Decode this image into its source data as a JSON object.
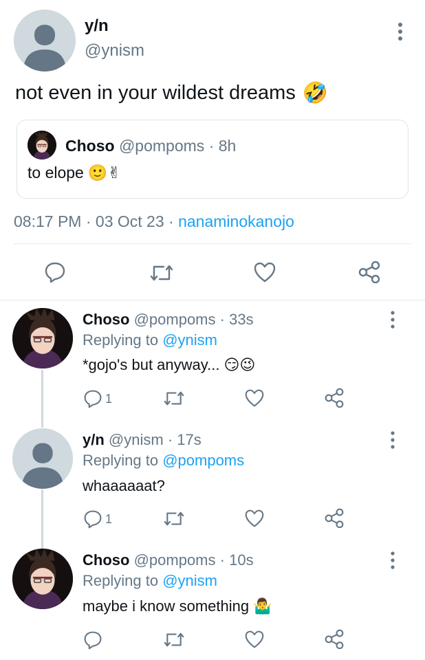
{
  "main_tweet": {
    "name": "y/n",
    "handle": "@ynism",
    "text": "not even in your wildest dreams",
    "emoji": "🤣",
    "quote": {
      "name": "Choso",
      "handle": "@pompoms",
      "separator": "·",
      "time": "8h",
      "text": "to elope",
      "emoji": "🙂✌"
    },
    "meta": {
      "time": "08:17 PM",
      "sep1": "·",
      "date": "03 Oct 23",
      "sep2": "·",
      "source": "nanaminokanojo"
    }
  },
  "replies": [
    {
      "name": "Choso",
      "handle": "@pompoms",
      "separator": "·",
      "time": "33s",
      "replying_label": "Replying to",
      "replying_to": "@ynism",
      "text": "*gojo's but anyway...",
      "emoji": "😏😉",
      "reply_count": "1",
      "avatar": "choso"
    },
    {
      "name": "y/n",
      "handle": "@ynism",
      "separator": "·",
      "time": "17s",
      "replying_label": "Replying to",
      "replying_to": "@pompoms",
      "text": "whaaaaaat?",
      "emoji": "",
      "reply_count": "1",
      "avatar": "default"
    },
    {
      "name": "Choso",
      "handle": "@pompoms",
      "separator": "·",
      "time": "10s",
      "replying_label": "Replying to",
      "replying_to": "@ynism",
      "text": "maybe i know something",
      "emoji": "🤷‍♂️",
      "reply_count": "",
      "avatar": "choso"
    }
  ],
  "icons": {
    "reply": "reply-icon",
    "retweet": "retweet-icon",
    "like": "heart-icon",
    "share": "share-icon",
    "more": "more-dots-icon"
  },
  "colors": {
    "link": "#1da1f2",
    "muted": "#657786",
    "divider": "#e1e8ed"
  }
}
